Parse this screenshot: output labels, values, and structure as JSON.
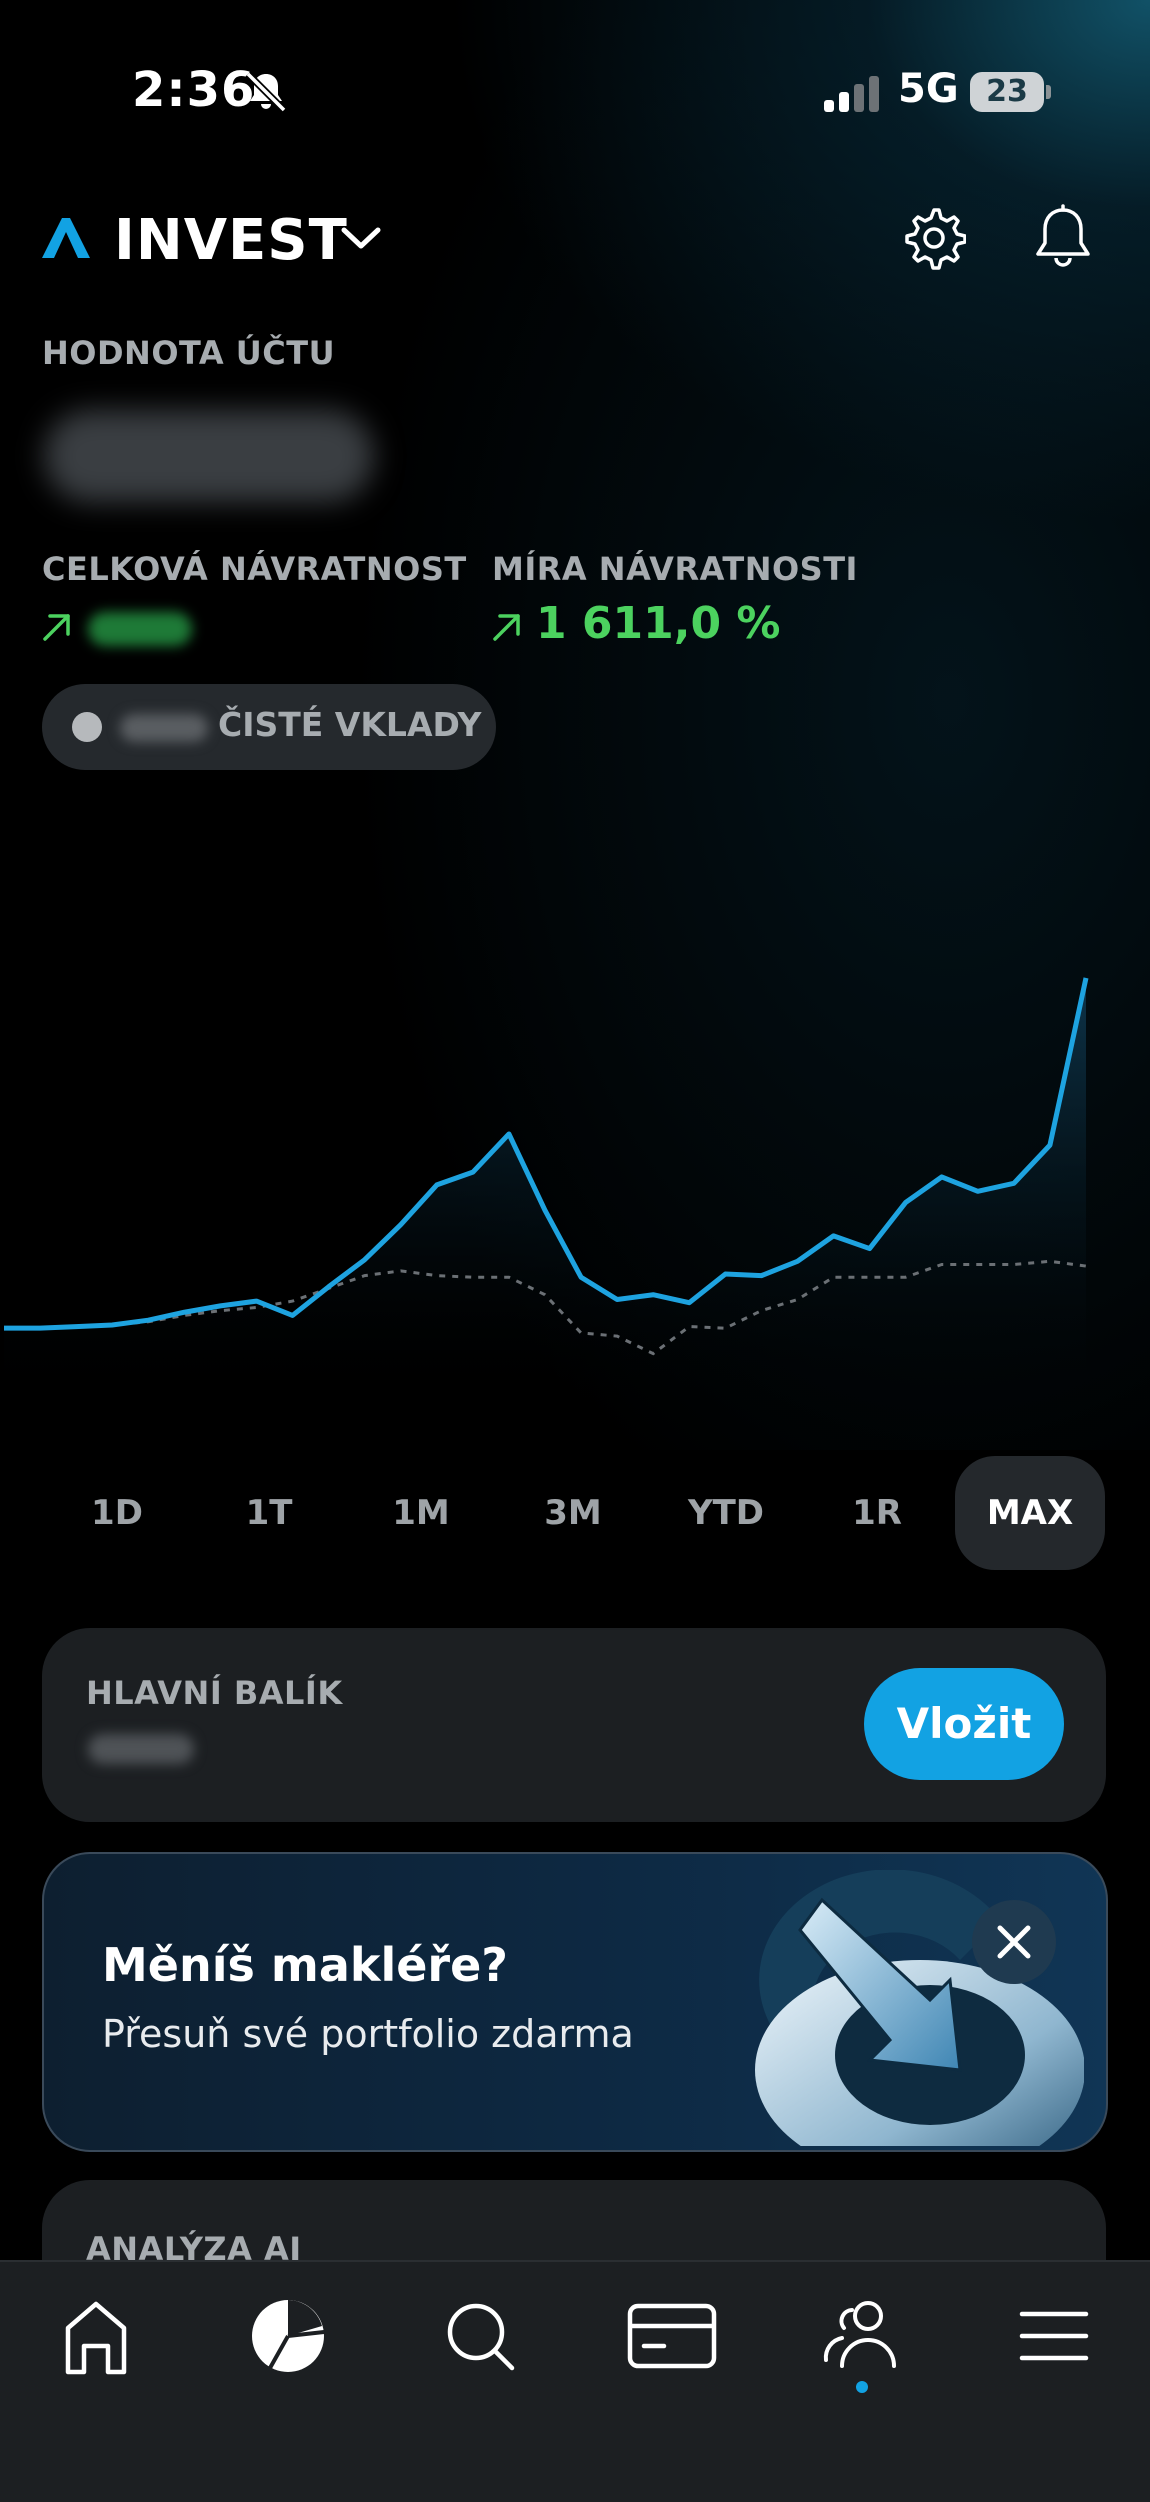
{
  "status": {
    "time": "2:36",
    "network": "5G",
    "battery": "23"
  },
  "header": {
    "app_name": "INVEST"
  },
  "account": {
    "value_label": "HODNOTA ÚČTU"
  },
  "returns": {
    "total_label": "CELKOVÁ NÁVRATNOST",
    "rate_label": "MÍRA NÁVRATNOSTI",
    "rate_value": "1 611,0 %"
  },
  "deposits_label": "ČISTÉ VKLADY",
  "chart_data": {
    "type": "line",
    "series": [
      {
        "values": [
          0.0,
          0.0,
          0.1,
          0.2,
          0.5,
          1.0,
          1.4,
          1.7,
          0.8,
          2.6,
          4.3,
          6.5,
          9.0,
          9.8,
          12.2,
          7.4,
          3.2,
          1.8,
          2.1,
          1.6,
          3.4,
          3.3,
          4.2,
          5.8,
          5.0,
          7.9,
          9.5,
          8.6,
          9.1,
          11.5,
          22.0
        ]
      },
      {
        "values": [
          0.0,
          0.0,
          0.1,
          0.2,
          0.4,
          0.8,
          1.1,
          1.3,
          1.7,
          2.5,
          3.3,
          3.6,
          3.3,
          3.2,
          3.2,
          2.1,
          -0.3,
          -0.5,
          -1.6,
          0.1,
          0.0,
          1.1,
          1.8,
          3.2,
          3.2,
          3.2,
          4.0,
          4.0,
          4.0,
          4.2,
          3.9
        ]
      }
    ],
    "colors": {
      "portfolio": "#1ea3e0",
      "deposits": "#6b7075"
    }
  },
  "ranges": {
    "items": [
      "1D",
      "1T",
      "1M",
      "3M",
      "YTD",
      "1R",
      "MAX"
    ],
    "selected": "MAX"
  },
  "main_package": {
    "label": "HLAVNÍ BALÍK",
    "deposit_button": "Vložit"
  },
  "promo": {
    "title": "Měníš makléře?",
    "subtitle": "Přesuň své portfolio zdarma"
  },
  "analysis": {
    "label": "ANALÝZA AI"
  },
  "accent_color": "#12a2e3",
  "positive_color": "#4cd25f"
}
